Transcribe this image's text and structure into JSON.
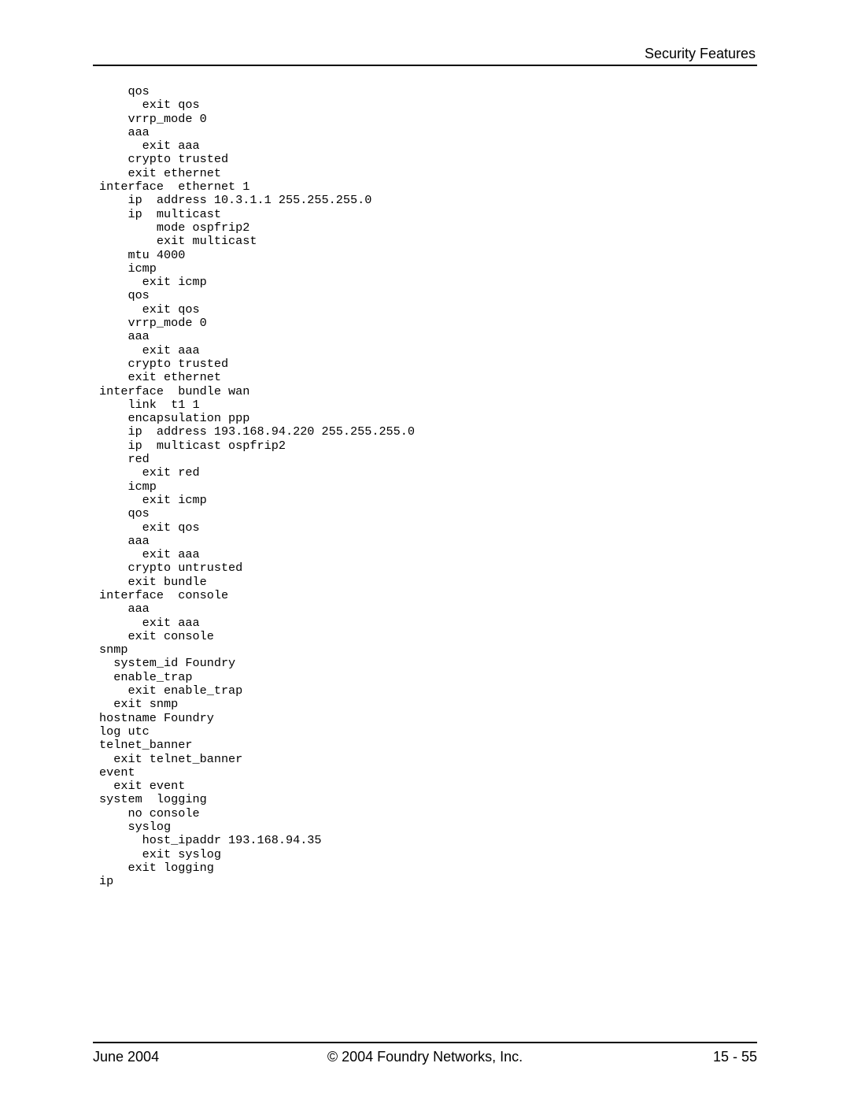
{
  "header": {
    "section_title": "Security Features"
  },
  "code": {
    "lines": [
      "    qos",
      "      exit qos",
      "    vrrp_mode 0",
      "    aaa",
      "      exit aaa",
      "    crypto trusted",
      "    exit ethernet",
      "interface  ethernet 1",
      "    ip  address 10.3.1.1 255.255.255.0",
      "    ip  multicast",
      "        mode ospfrip2",
      "        exit multicast",
      "    mtu 4000",
      "    icmp",
      "      exit icmp",
      "    qos",
      "      exit qos",
      "    vrrp_mode 0",
      "    aaa",
      "      exit aaa",
      "    crypto trusted",
      "    exit ethernet",
      "interface  bundle wan",
      "    link  t1 1",
      "    encapsulation ppp",
      "    ip  address 193.168.94.220 255.255.255.0",
      "    ip  multicast ospfrip2",
      "    red",
      "      exit red",
      "    icmp",
      "      exit icmp",
      "    qos",
      "      exit qos",
      "    aaa",
      "      exit aaa",
      "    crypto untrusted",
      "    exit bundle",
      "interface  console",
      "    aaa",
      "      exit aaa",
      "    exit console",
      "snmp",
      "  system_id Foundry",
      "  enable_trap",
      "    exit enable_trap",
      "  exit snmp",
      "hostname Foundry",
      "log utc",
      "telnet_banner",
      "  exit telnet_banner",
      "event",
      "  exit event",
      "system  logging",
      "    no console",
      "    syslog",
      "      host_ipaddr 193.168.94.35",
      "      exit syslog",
      "    exit logging",
      "ip"
    ]
  },
  "footer": {
    "date": "June 2004",
    "copyright": "© 2004 Foundry Networks, Inc.",
    "page_number": "15 - 55"
  }
}
